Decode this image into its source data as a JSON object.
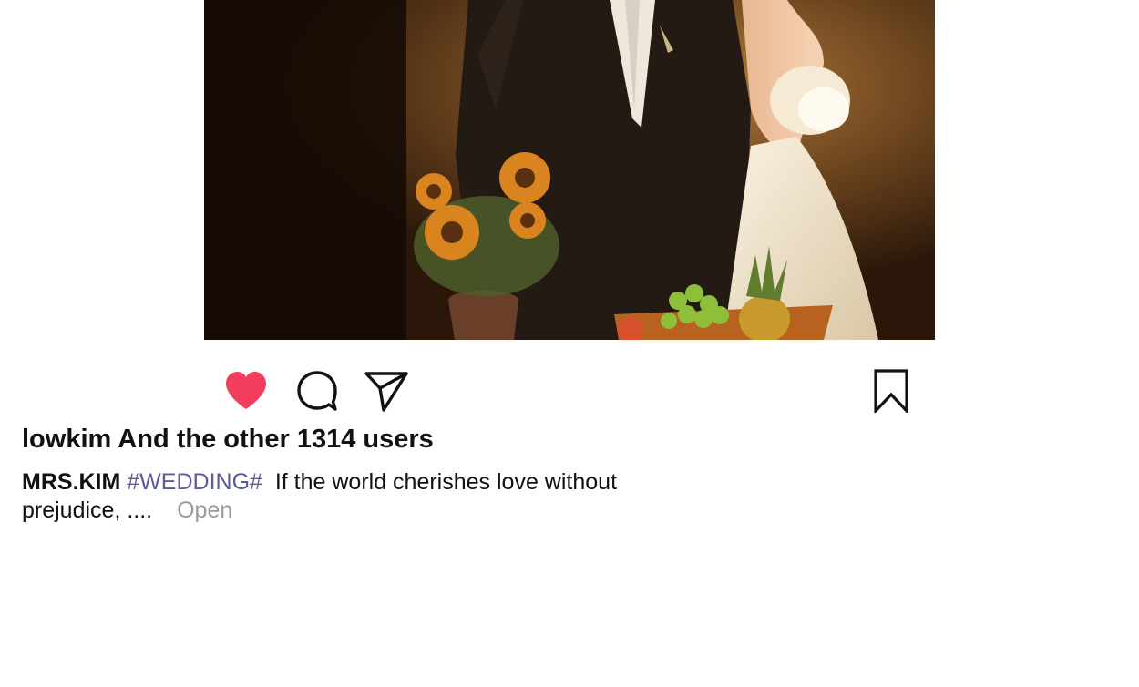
{
  "post": {
    "photo_alt": "wedding-couple-photo",
    "actions": {
      "like_icon": "heart-icon",
      "comment_icon": "comment-icon",
      "share_icon": "paper-plane-icon",
      "save_icon": "bookmark-icon",
      "liked": true,
      "like_color": "#f23d5c"
    },
    "likes_text": "lowkim And the other 1314 users",
    "caption": {
      "author": "MRS.KIM",
      "hashtag": "#WEDDING#",
      "text": "If the world cherishes love without prejudice, ....",
      "more_label": "Open",
      "hashtag_color": "#5a5b9a"
    }
  }
}
